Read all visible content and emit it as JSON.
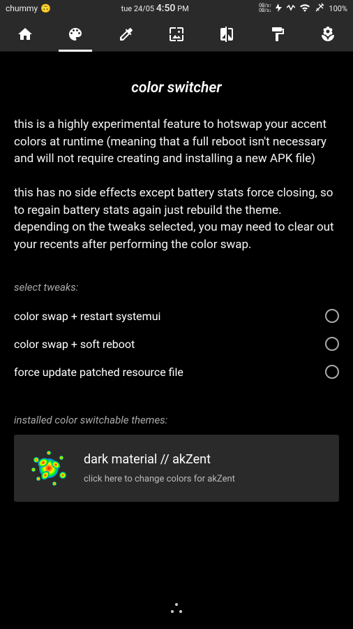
{
  "status": {
    "app_name": "chummy",
    "emoji": "🙃",
    "date_prefix": "tue 24/05",
    "time": "4:50",
    "time_suffix": "PM",
    "data_up": "0B/s",
    "data_down": "0B/s",
    "battery": "100%"
  },
  "page": {
    "title": "color switcher",
    "desc1": "this is a highly experimental feature to hotswap your accent colors at runtime (meaning that a full reboot isn't necessary and will not require creating and installing a new APK file)",
    "desc2": "this has no side effects except battery stats force closing, so to regain battery stats again just rebuild the theme. depending on the tweaks selected, you may need to clear out your recents after performing the color swap."
  },
  "tweaks": {
    "label": "select tweaks:",
    "items": [
      {
        "label": "color swap + restart systemui"
      },
      {
        "label": "color swap + soft reboot"
      },
      {
        "label": "force update patched resource file"
      }
    ]
  },
  "themes": {
    "label": "installed color switchable themes:",
    "items": [
      {
        "title": "dark material // akZent",
        "subtitle": "click here to change colors for akZent"
      }
    ]
  }
}
